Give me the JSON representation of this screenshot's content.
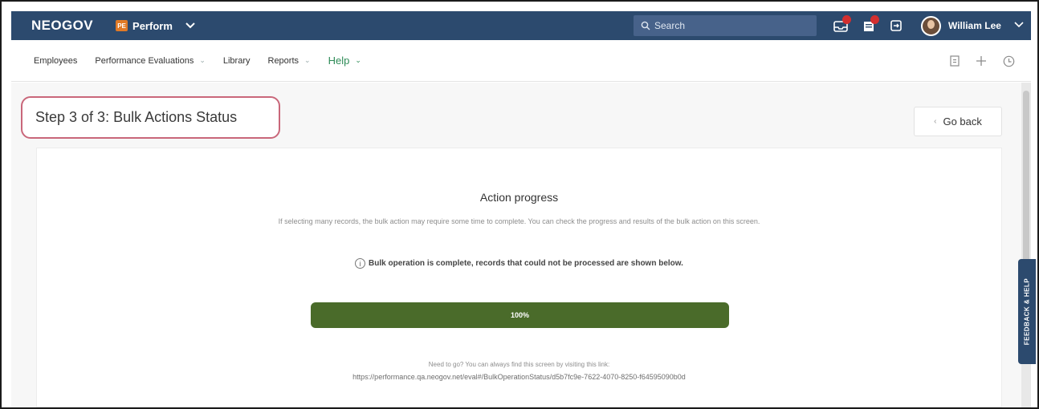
{
  "topbar": {
    "logo": "NEOGOV",
    "product_badge": "PE",
    "product_name": "Perform",
    "search_placeholder": "Search",
    "user_name": "William Lee",
    "icons": [
      "inbox-icon",
      "notifications-icon",
      "tasks-icon",
      "avatar",
      "chevron-down-icon"
    ],
    "brand_color": "#2c4a6e"
  },
  "subnav": {
    "items": [
      {
        "label": "Employees"
      },
      {
        "label": "Performance Evaluations"
      },
      {
        "label": "Library"
      },
      {
        "label": "Reports"
      },
      {
        "label": "Help"
      }
    ],
    "right_icons": [
      "document-icon",
      "plus-icon",
      "clock-icon"
    ]
  },
  "page": {
    "step_title": "Step 3 of 3: Bulk Actions Status",
    "go_back": "Go back"
  },
  "card": {
    "title": "Action progress",
    "description": "If selecting many records, the bulk action may require some time to complete. You can check the progress and results of the bulk action on this screen.",
    "status": "Bulk operation is complete, records that could not be processed are shown below.",
    "progress_label": "100%",
    "progress_value": 1.0,
    "progress_color": "#4a6b2a",
    "need_to_go": "Need to go? You can always find this screen by visiting this link:",
    "link": "https://performance.qa.neogov.net/eval#/BulkOperationStatus/d5b7fc9e-7622-4070-8250-f64595090b0d"
  },
  "feedback_tab": "FEEDBACK & HELP"
}
